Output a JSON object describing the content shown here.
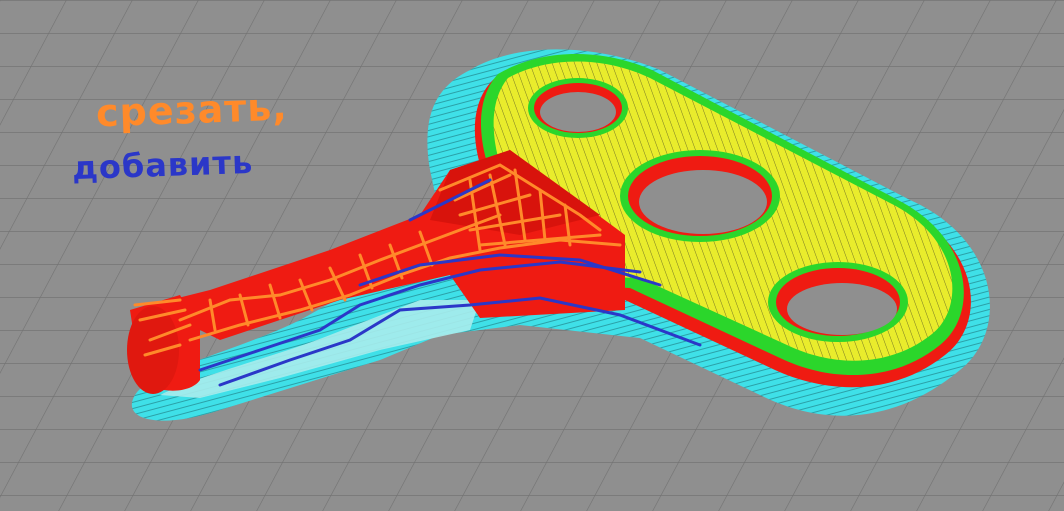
{
  "colors": {
    "bed": "#8f8f8f",
    "grid": "#6f6f6f",
    "skirt": "#3fe0e8",
    "outer_wall": "#ef1b12",
    "inner_wall": "#2bd62b",
    "infill": "#e9ec2c",
    "support": "#9fe3e3",
    "annotation_orange": "#ff8a2a",
    "annotation_blue": "#2b37c8"
  },
  "annotations": {
    "cut_label": "срезать,",
    "add_label": "добавить"
  }
}
